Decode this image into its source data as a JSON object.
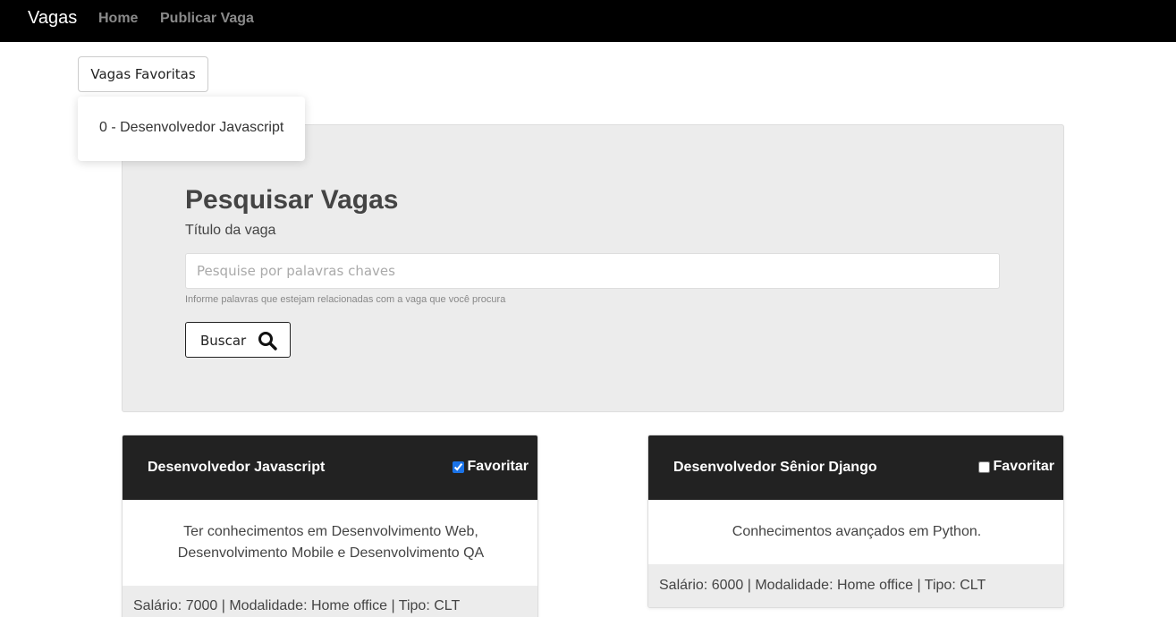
{
  "navbar": {
    "brand": "Vagas",
    "links": [
      "Home",
      "Publicar Vaga"
    ]
  },
  "favorites": {
    "button_label": "Vagas Favoritas",
    "items": [
      "0 - Desenvolvedor Javascript"
    ]
  },
  "search": {
    "title": "Pesquisar Vagas",
    "label": "Título da vaga",
    "placeholder": "Pesquise por palavras chaves",
    "value": "",
    "help": "Informe palavras que estejam relacionadas com a vaga que você procura",
    "button_label": "Buscar",
    "button_icon": "search-icon"
  },
  "jobs": [
    {
      "title": "Desenvolvedor Javascript",
      "favorite_label": "Favoritar",
      "favorited": true,
      "description": "Ter conhecimentos em Desenvolvimento Web, Desenvolvimento Mobile e Desenvolvimento QA",
      "details": "Salário: 7000 | Modalidade: Home office | Tipo: CLT"
    },
    {
      "title": "Desenvolvedor Sênior Django",
      "favorite_label": "Favoritar",
      "favorited": false,
      "description": "Conhecimentos avançados em Python.",
      "details": "Salário: 6000 | Modalidade: Home office | Tipo: CLT"
    }
  ],
  "colors": {
    "navbar_bg": "#000000",
    "card_header_bg": "#222222",
    "panel_bg": "#ececec",
    "checkbox_accent": "#1a73e8"
  }
}
